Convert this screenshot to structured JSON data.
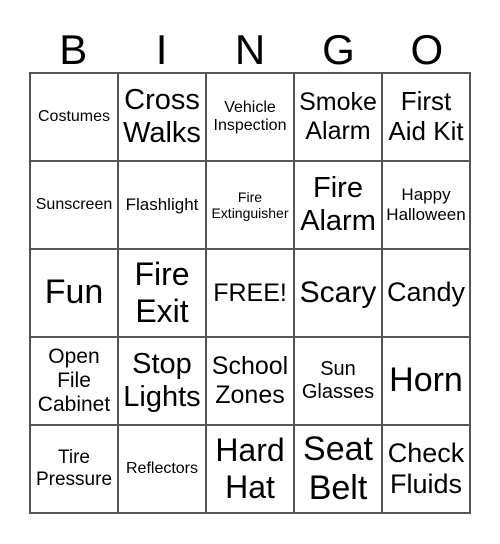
{
  "header": [
    "B",
    "I",
    "N",
    "G",
    "O"
  ],
  "cells": [
    "Costumes",
    "Cross\nWalks",
    "Vehicle\nInspection",
    "Smoke\nAlarm",
    "First\nAid Kit",
    "Sunscreen",
    "Flashlight",
    "Fire\nExtinguisher",
    "Fire\nAlarm",
    "Happy\nHalloween",
    "Fun",
    "Fire\nExit",
    "FREE!",
    "Scary",
    "Candy",
    "Open\nFile\nCabinet",
    "Stop\nLights",
    "School\nZones",
    "Sun\nGlasses",
    "Horn",
    "Tire\nPressure",
    "Reflectors",
    "Hard\nHat",
    "Seat\nBelt",
    "Check\nFluids"
  ]
}
